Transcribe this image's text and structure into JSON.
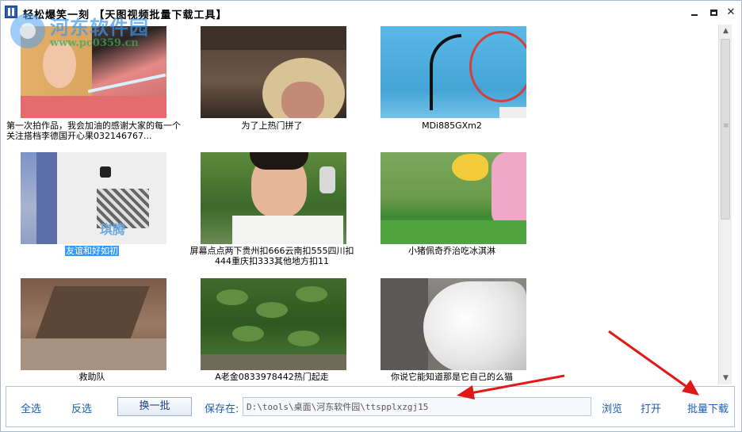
{
  "window": {
    "title": "轻松爆笑一刻 【天图视频批量下载工具】"
  },
  "watermark": {
    "name": "河东软件园",
    "url": "www.pc0359.cn"
  },
  "videos": [
    {
      "caption": "第一次拍作品，我会加油的感谢大家的每一个关注搭档李德国开心果032146767...",
      "selected": false
    },
    {
      "caption": "为了上热门拼了",
      "selected": false
    },
    {
      "caption": "MDi885GXm2",
      "selected": false
    },
    {
      "caption": "友谊和好如初",
      "selected": true
    },
    {
      "caption": "屏幕点点两下贵州扣666云南扣555四川扣444重庆扣333其他地方扣11",
      "selected": false
    },
    {
      "caption": "小猪佩奇乔治吃冰淇淋",
      "selected": false
    },
    {
      "caption": "救助队",
      "selected": false
    },
    {
      "caption": "A老金0833978442热门起走",
      "selected": false
    },
    {
      "caption": "你说它能知道那是它自己的么猫",
      "selected": false
    }
  ],
  "thumb4_overlay": "琪腾",
  "toolbar": {
    "select_all": "全选",
    "invert": "反选",
    "next_batch": "换一批",
    "save_to_label": "保存在:",
    "save_path": "D:\\tools\\桌面\\河东软件园\\ttspplxzgj15",
    "browse": "浏览",
    "open": "打开",
    "batch_download": "批量下载"
  },
  "colors": {
    "accent": "#1a5fb4",
    "selection": "#3399ff",
    "arrow": "#e01818"
  }
}
